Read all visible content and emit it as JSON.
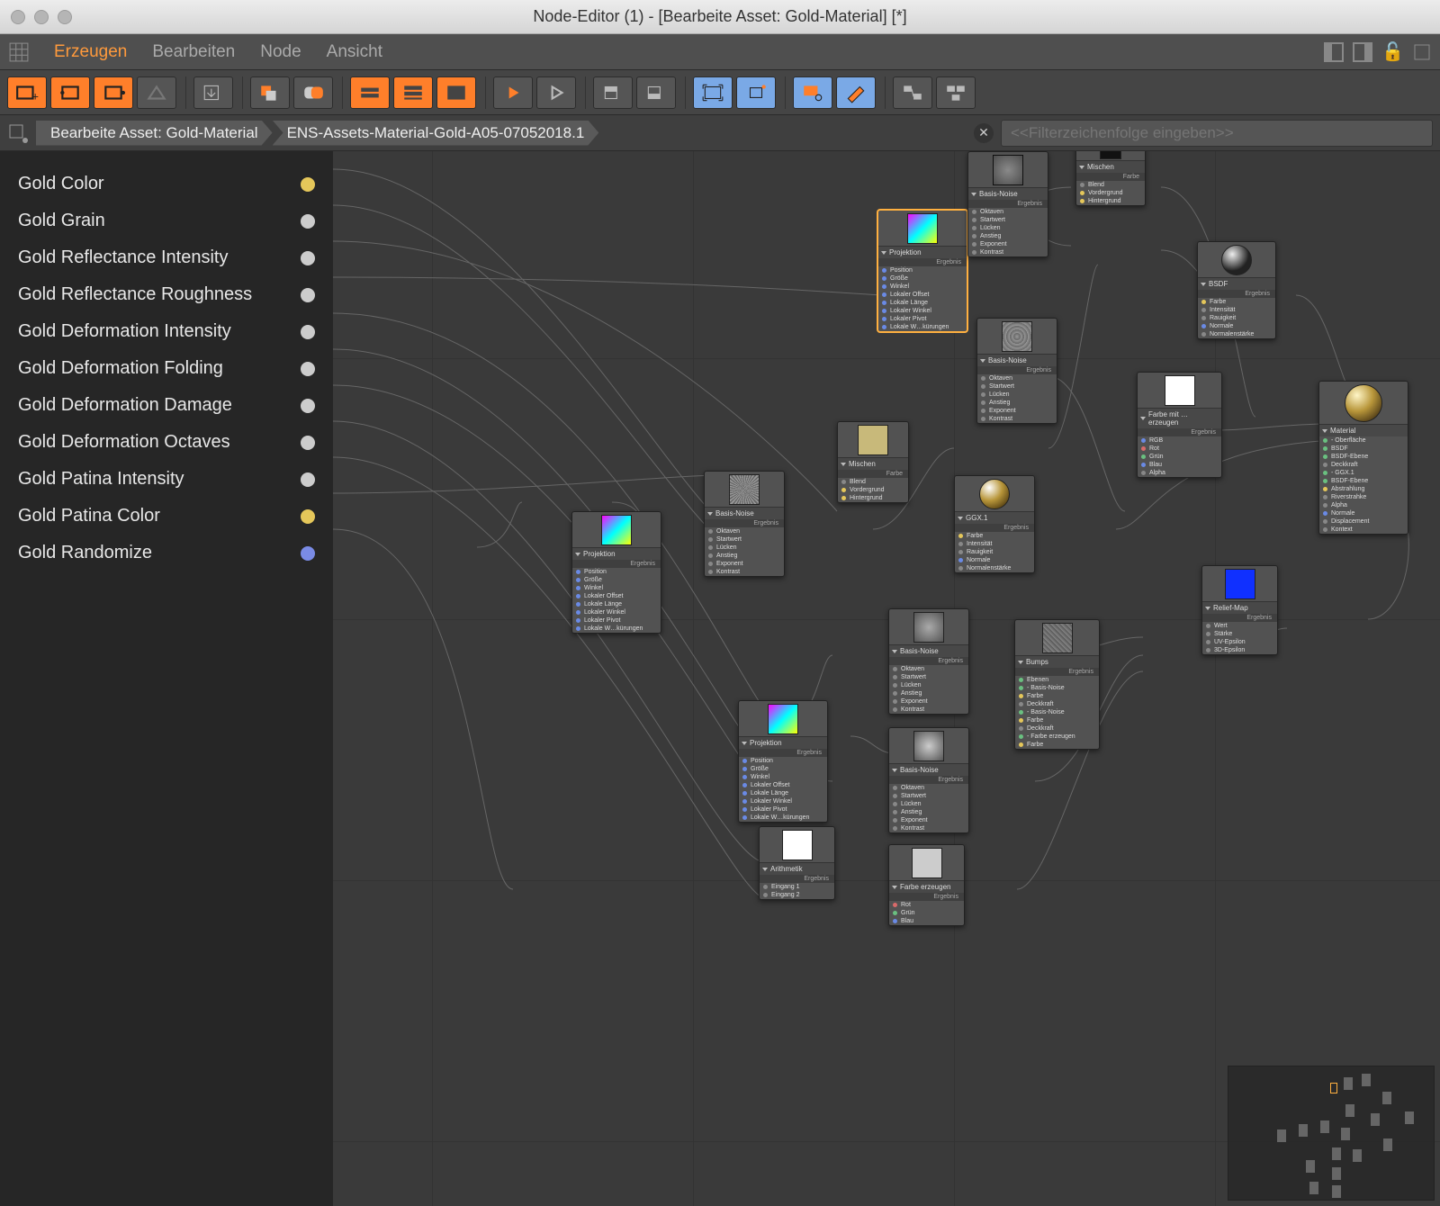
{
  "window": {
    "title": "Node-Editor (1) - [Bearbeite Asset: Gold-Material] [*]"
  },
  "menu": {
    "items": [
      "Erzeugen",
      "Bearbeiten",
      "Node",
      "Ansicht"
    ],
    "active_index": 0
  },
  "path": {
    "crumbs": [
      "Bearbeite Asset: Gold-Material",
      "ENS-Assets-Material-Gold-A05-07052018.1"
    ]
  },
  "filter": {
    "placeholder": "<<Filterzeichenfolge eingeben>>"
  },
  "sidebar": {
    "params": [
      {
        "label": "Gold Color",
        "dot": "yellow"
      },
      {
        "label": "Gold Grain",
        "dot": "gray"
      },
      {
        "label": "Gold Reflectance Intensity",
        "dot": "gray"
      },
      {
        "label": "Gold Reflectance Roughness",
        "dot": "gray"
      },
      {
        "label": "Gold Deformation Intensity",
        "dot": "gray"
      },
      {
        "label": "Gold Deformation Folding",
        "dot": "gray"
      },
      {
        "label": "Gold Deformation Damage",
        "dot": "gray"
      },
      {
        "label": "Gold Deformation Octaves",
        "dot": "gray"
      },
      {
        "label": "Gold Patina Intensity",
        "dot": "gray"
      },
      {
        "label": "Gold Patina Color",
        "dot": "yellow"
      },
      {
        "label": "Gold Randomize",
        "dot": "blue"
      }
    ]
  },
  "nodes": {
    "result_label": "Ergebnis",
    "projektion": {
      "title": "Projektion",
      "ports": [
        "Position",
        "Größe",
        "Winkel",
        "Lokaler Offset",
        "Lokale Länge",
        "Lokaler Winkel",
        "Lokaler Pivot",
        "Lokale W…kürungen"
      ]
    },
    "basisnoise": {
      "title": "Basis-Noise",
      "ports": [
        "Oktaven",
        "Startwert",
        "Lücken",
        "Anstieg",
        "Exponent",
        "Kontrast"
      ]
    },
    "mischen": {
      "title": "Mischen",
      "sect": "Farbe",
      "ports": [
        "Blend",
        "Vordergrund",
        "Hintergrund"
      ]
    },
    "ggx": {
      "title": "GGX.1",
      "ports": [
        "Farbe",
        "Intensität",
        "Rauigkeit",
        "Normale",
        "Normalenstärke"
      ]
    },
    "bsdf": {
      "title": "BSDF",
      "ports": [
        "Farbe",
        "Intensität",
        "Rauigkeit",
        "Normale",
        "Normalenstärke"
      ]
    },
    "farbemit": {
      "title": "Farbe mit … erzeugen",
      "ports": [
        "RGB",
        "Rot",
        "Grün",
        "Blau",
        "Alpha"
      ]
    },
    "farbeerzeugen": {
      "title": "Farbe erzeugen",
      "ports": [
        "Rot",
        "Grün",
        "Blau"
      ]
    },
    "arithmetik": {
      "title": "Arithmetik",
      "ports": [
        "Eingang 1",
        "Eingang 2"
      ]
    },
    "bumps": {
      "title": "Bumps",
      "ports_grouped": [
        "Ebenen",
        "- Basis-Noise",
        "  Farbe",
        "  Deckkraft",
        "- Basis-Noise",
        "  Farbe",
        "  Deckkraft",
        "- Farbe erzeugen",
        "  Farbe"
      ]
    },
    "reliefmap": {
      "title": "Relief-Map",
      "ports": [
        "Wert",
        "Stärke",
        "UV-Epsilon",
        "3D-Epsilon"
      ]
    },
    "material": {
      "title": "Material",
      "ports": [
        "- Oberfläche",
        "  BSDF",
        "  BSDF-Ebene",
        "  Deckkraft",
        "- GGX.1",
        "  BSDF-Ebene",
        "Abstrahlung",
        "Riverstrahke",
        "Alpha",
        "Normale",
        "Displacement",
        "Kontext"
      ]
    }
  },
  "colors": {
    "accent": "#ff7f2a",
    "blue_accent": "#7aa9e6",
    "gold_preview": "#b8963a",
    "relief_blue": "#1030ff",
    "patina": "#a8c088"
  }
}
